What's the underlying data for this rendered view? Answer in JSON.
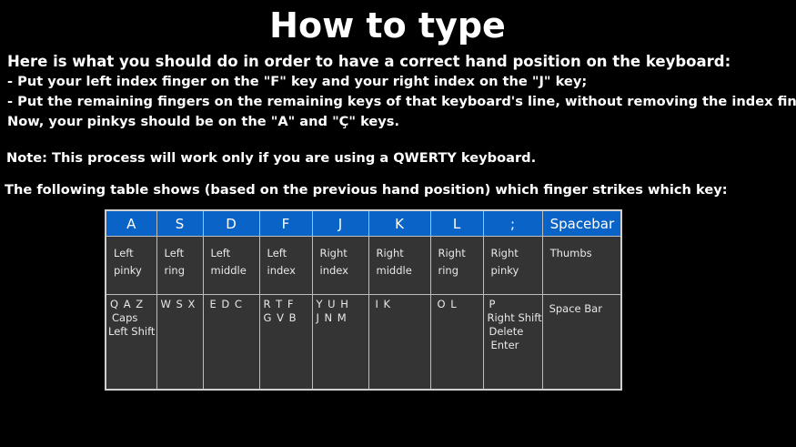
{
  "title": "How to type",
  "intro": "Here is what you should do in order to have a correct hand position on the keyboard:",
  "steps": [
    "- Put your left index finger on the \"F\" key and your right index on the \"J\" key;",
    "- Put the remaining fingers on the remaining keys of that keyboard's line, without removing the index fingers;",
    "Now, your pinkys should be on the \"A\" and \"Ç\" keys."
  ],
  "note": "Note: This process will work only if you are using a QWERTY keyboard.",
  "table_intro": "The following table shows (based on the previous hand position) which finger strikes which key:",
  "colors": {
    "background": "#000000",
    "header_bg": "#0a64c8",
    "cell_bg": "#343434",
    "text": "#ffffff"
  },
  "table": {
    "headers": [
      "A",
      "S",
      "D",
      "F",
      "J",
      "K",
      "L",
      ";",
      "Spacebar"
    ],
    "fingers": [
      [
        "Left",
        "pinky"
      ],
      [
        "Left",
        "ring"
      ],
      [
        "Left",
        "middle"
      ],
      [
        "Left",
        "index"
      ],
      [
        "Right",
        "index"
      ],
      [
        "Right",
        "middle"
      ],
      [
        "Right",
        "ring"
      ],
      [
        "Right",
        "pinky"
      ],
      [
        "Thumbs"
      ]
    ],
    "keys": [
      [
        "Q A Z",
        "Caps",
        "Left Shift"
      ],
      [
        "W S X"
      ],
      [
        "E D C"
      ],
      [
        "R T F",
        "G V B"
      ],
      [
        "Y U H",
        "J N M"
      ],
      [
        "I K"
      ],
      [
        "O L"
      ],
      [
        "P",
        "Right Shift",
        "Delete",
        "Enter"
      ],
      [
        "Space Bar"
      ]
    ]
  }
}
